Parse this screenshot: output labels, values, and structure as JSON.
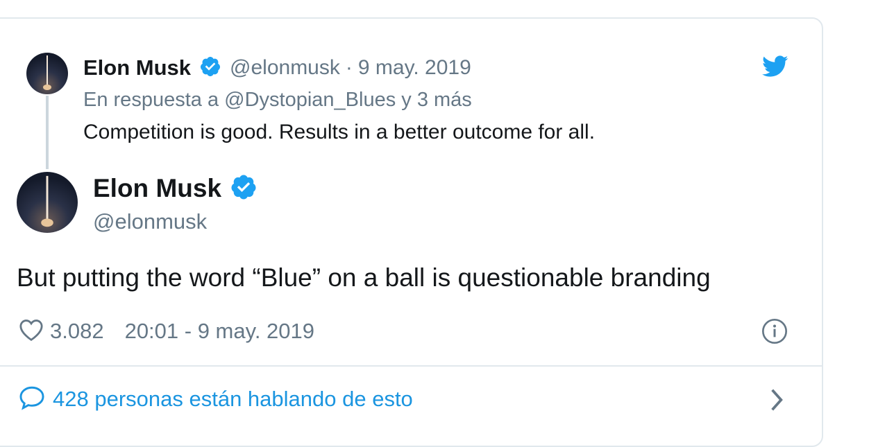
{
  "parent": {
    "name": "Elon Musk",
    "handle": "@elonmusk",
    "sep": "·",
    "date": "9 may. 2019",
    "reply_prefix": "En respuesta a",
    "reply_users": "@Dystopian_Blues y 3 más",
    "text": "Competition is good. Results in a better outcome for all."
  },
  "main": {
    "name": "Elon Musk",
    "handle": "@elonmusk",
    "text": "But putting the word “Blue” on a ball is questionable branding",
    "likes": "3.082",
    "timestamp": "20:01 - 9 may. 2019"
  },
  "footer": {
    "conversation": "428 personas están hablando de esto"
  },
  "colors": {
    "twitter_blue": "#1da1f2",
    "verified": "#1da1f2",
    "link": "#1b95e0",
    "muted": "#657786",
    "border": "#e1e8ed"
  },
  "icons": [
    "twitter-bird-icon",
    "verified-badge-icon",
    "heart-icon",
    "info-icon",
    "speech-bubble-icon",
    "chevron-right-icon"
  ]
}
